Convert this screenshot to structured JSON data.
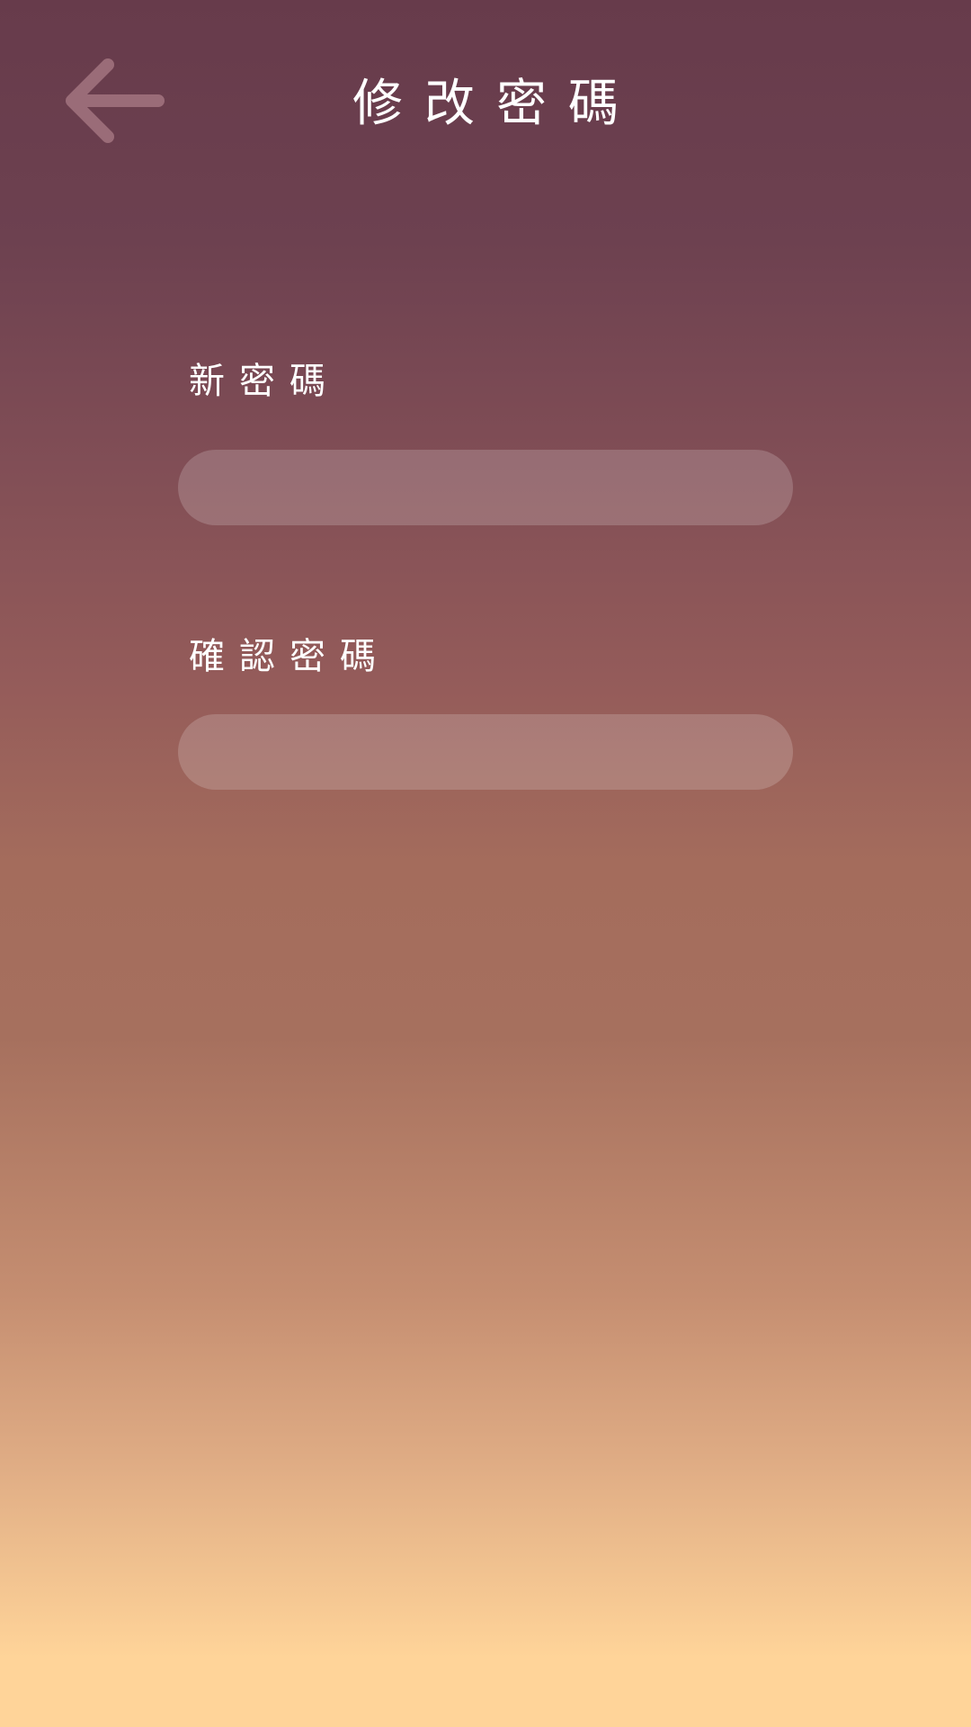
{
  "header": {
    "title": "修改密碼",
    "back_icon": "arrow-left-icon"
  },
  "form": {
    "new_password": {
      "label": "新密碼",
      "value": "",
      "placeholder": ""
    },
    "confirm_password": {
      "label": "確認密碼",
      "value": "",
      "placeholder": ""
    }
  },
  "colors": {
    "gradient_top": "#673b4b",
    "gradient_middle": "#a46c5c",
    "gradient_bottom": "#ffd499",
    "text": "#ffffff",
    "input_fill": "rgba(255,255,255,0.18)"
  }
}
